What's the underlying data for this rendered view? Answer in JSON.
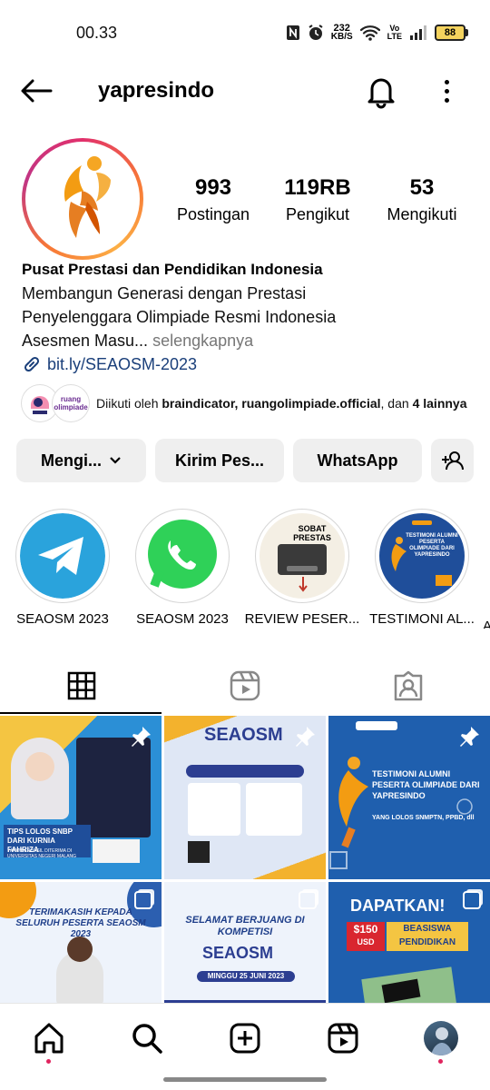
{
  "status_bar": {
    "time": "00.33",
    "net_speed_value": "232",
    "net_speed_unit": "KB/S",
    "volte_top": "Vo",
    "volte_bottom": "LTE",
    "battery": "88"
  },
  "header": {
    "username": "yapresindo"
  },
  "profile": {
    "stats": [
      {
        "value": "993",
        "label": "Postingan"
      },
      {
        "value": "119RB",
        "label": "Pengikut"
      },
      {
        "value": "53",
        "label": "Mengikuti"
      }
    ],
    "name": "Pusat Prestasi dan Pendidikan Indonesia",
    "bio_lines": [
      "Membangun Generasi dengan Prestasi",
      "Penyelenggara Olimpiade Resmi Indonesia",
      "Asesmen Masu..."
    ],
    "more": "selengkapnya",
    "link": "bit.ly/SEAOSM-2023",
    "followed_by": {
      "prefix": "Diikuti oleh",
      "accounts": "braindicator, ruangolimpiade.official",
      "middle": ", dan",
      "count": "4",
      "suffix": "lainnya",
      "avatar2_text": "ruang olimpiade"
    }
  },
  "actions": {
    "follow": "Mengi...",
    "message": "Kirim Pes...",
    "whatsapp": "WhatsApp"
  },
  "highlights": [
    {
      "label": "SEAOSM 2023",
      "icon": "telegram-icon"
    },
    {
      "label": "SEAOSM 2023",
      "icon": "whatsapp-icon"
    },
    {
      "label": "REVIEW PESER...",
      "icon": "review-thumbnail",
      "title": "SOBAT PRESTAS"
    },
    {
      "label": "TESTIMONI AL...",
      "icon": "testimoni-thumbnail",
      "title": "TESTIMONI ALUMNI PESERTA OLIMPIADE DARI YAPRESINDO"
    },
    {
      "label": "A"
    }
  ],
  "tabs": [
    "grid-icon",
    "reels-icon",
    "tagged-icon"
  ],
  "posts": [
    {
      "caption": "TIPS LOLOS SNBP DARI KURNIA FAHRIZA",
      "sub": "YANG BERHASIL DITERIMA DI UNIVERSITAS NEGERI MALANG",
      "pinned": true
    },
    {
      "caption": "SEAOSM",
      "pinned": true
    },
    {
      "caption": "TESTIMONI ALUMNI PESERTA OLIMPIADE DARI YAPRESINDO",
      "sub": "YANG LOLOS SNMPTN, PPBD, dll",
      "pinned": true
    },
    {
      "caption": "TERIMAKASIH KEPADA SELURUH PESERTA SEAOSM 2023",
      "multi": true
    },
    {
      "caption": "SELAMAT BERJUANG DI KOMPETISI",
      "sub": "MINGGU 25 JUNI 2023",
      "brand": "SEAOSM",
      "multi": true
    },
    {
      "caption": "DAPATKAN!",
      "price": "$150",
      "currency": "USD",
      "sub": "BEASISWA PENDIDIKAN",
      "multi": true
    }
  ],
  "colors": {
    "link": "#1a3f7a",
    "brand_blue": "#1f4e9a",
    "accent_orange": "#f39c12",
    "notification_dot": "#e0245e"
  }
}
